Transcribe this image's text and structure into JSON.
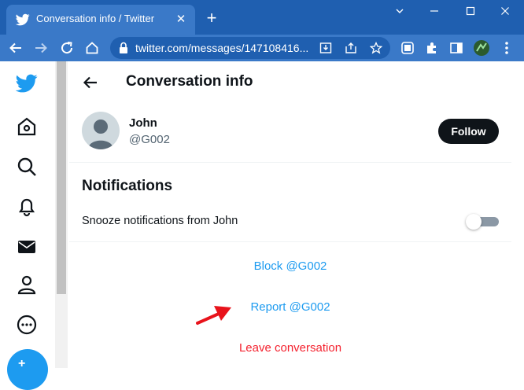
{
  "browser": {
    "tab_title": "Conversation info / Twitter",
    "tab_close": "✕",
    "new_tab": "+",
    "url": "twitter.com/messages/147108416..."
  },
  "sidebar": {
    "items": [
      {
        "name": "twitter-logo-icon"
      },
      {
        "name": "home-icon"
      },
      {
        "name": "explore-search-icon"
      },
      {
        "name": "notifications-bell-icon"
      },
      {
        "name": "messages-mail-icon"
      },
      {
        "name": "profile-person-icon"
      },
      {
        "name": "more-icon"
      }
    ],
    "compose_label": "+"
  },
  "header": {
    "title": "Conversation info"
  },
  "user": {
    "name": "John",
    "handle": "@G002",
    "follow_label": "Follow"
  },
  "notifications": {
    "title": "Notifications",
    "snooze_label": "Snooze notifications from John",
    "snooze_enabled": false
  },
  "actions": {
    "block_label": "Block @G002",
    "report_label": "Report @G002",
    "leave_label": "Leave conversation"
  },
  "colors": {
    "twitter_blue": "#1d9bf0",
    "danger_red": "#f4212e",
    "chrome_dark": "#1f5fb0",
    "chrome_light": "#3a79c8",
    "annotation_arrow": "#e8131b"
  }
}
